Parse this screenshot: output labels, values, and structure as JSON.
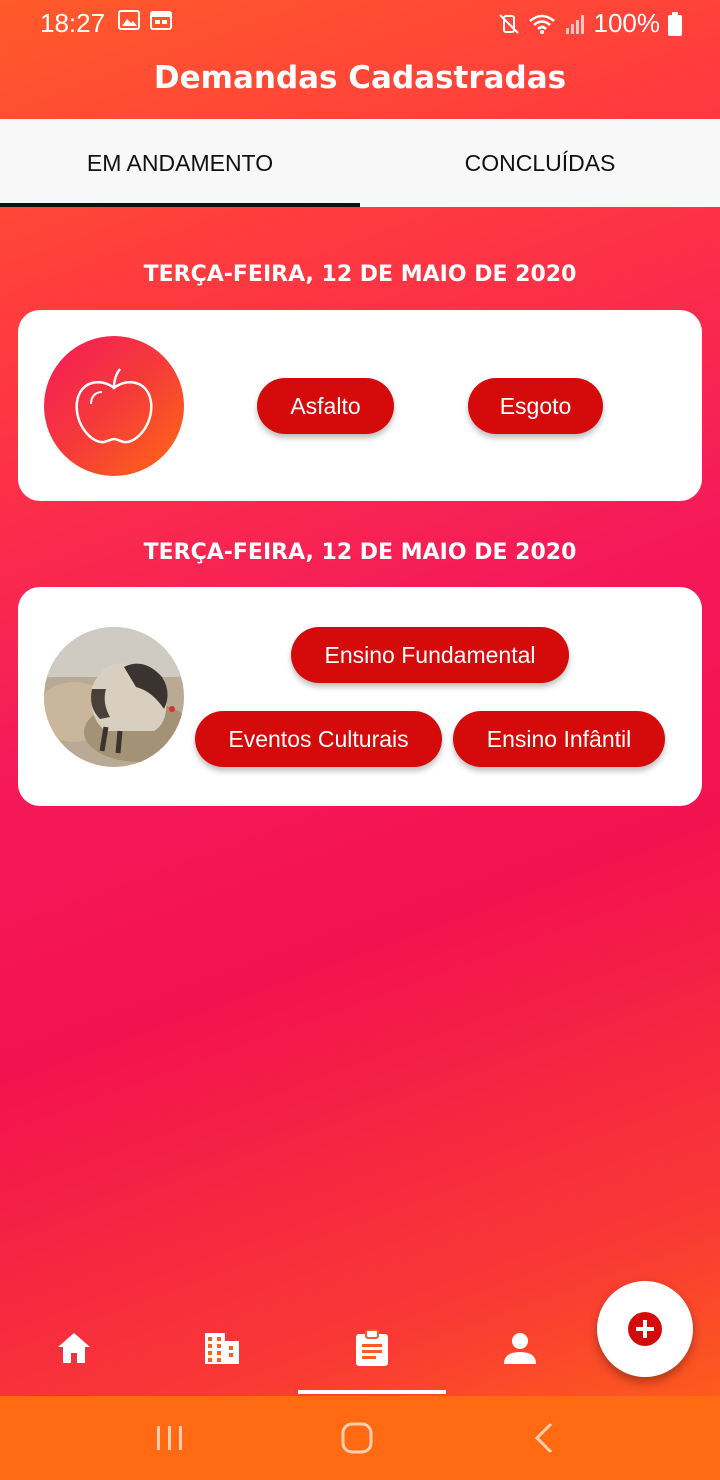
{
  "status_bar": {
    "time": "18:27",
    "battery": "100%",
    "icons": [
      "image-icon",
      "calendar-icon",
      "mute-icon",
      "wifi-icon",
      "signal-icon",
      "battery-icon"
    ]
  },
  "header": {
    "title": "Demandas Cadastradas"
  },
  "tabs": [
    {
      "label": "EM ANDAMENTO",
      "active": true
    },
    {
      "label": "CONCLUÍDAS",
      "active": false
    }
  ],
  "demands": [
    {
      "date": "TERÇA-FEIRA, 12 DE MAIO DE 2020",
      "avatar": "apple-icon",
      "tags": [
        "Asfalto",
        "Esgoto"
      ]
    },
    {
      "date": "TERÇA-FEIRA, 12 DE MAIO DE 2020",
      "avatar": "cat-photo",
      "tags": [
        "Ensino Fundamental",
        "Eventos Culturais",
        "Ensino Infântil"
      ]
    }
  ],
  "bottom_nav": {
    "items": [
      "home-icon",
      "building-icon",
      "clipboard-icon",
      "person-icon"
    ],
    "active": "clipboard-icon"
  },
  "fab": {
    "icon": "add-circle-icon"
  },
  "colors": {
    "chip": "#d50b0b",
    "gradient_start": "#ff5a2a",
    "gradient_mid": "#f3124f",
    "gradient_end": "#ff6a12"
  }
}
